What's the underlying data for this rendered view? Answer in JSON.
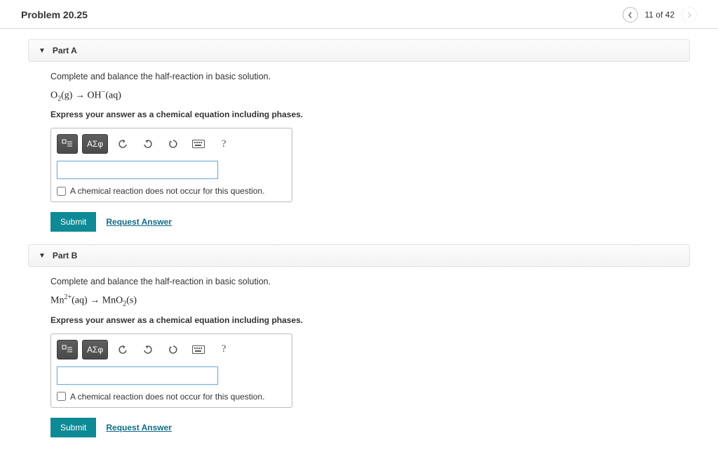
{
  "header": {
    "problem_label": "Problem 20.25",
    "nav_progress": "11 of 42"
  },
  "parts": {
    "a": {
      "title": "Part A",
      "description": "Complete and balance the half-reaction in basic solution.",
      "equation_html": "O<sub>2</sub>(g) → OH<sup>−</sup>(aq)",
      "instruction": "Express your answer as a chemical equation including phases.",
      "toolbar": {
        "greek_label": "ΑΣφ",
        "help_label": "?"
      },
      "input_value": "",
      "no_reaction_label": "A chemical reaction does not occur for this question.",
      "submit_label": "Submit",
      "request_label": "Request Answer"
    },
    "b": {
      "title": "Part B",
      "description": "Complete and balance the half-reaction in basic solution.",
      "equation_html": "Mn<sup>2+</sup>(aq) → MnO<sub>2</sub>(s)",
      "instruction": "Express your answer as a chemical equation including phases.",
      "toolbar": {
        "greek_label": "ΑΣφ",
        "help_label": "?"
      },
      "input_value": "",
      "no_reaction_label": "A chemical reaction does not occur for this question.",
      "submit_label": "Submit",
      "request_label": "Request Answer"
    }
  }
}
